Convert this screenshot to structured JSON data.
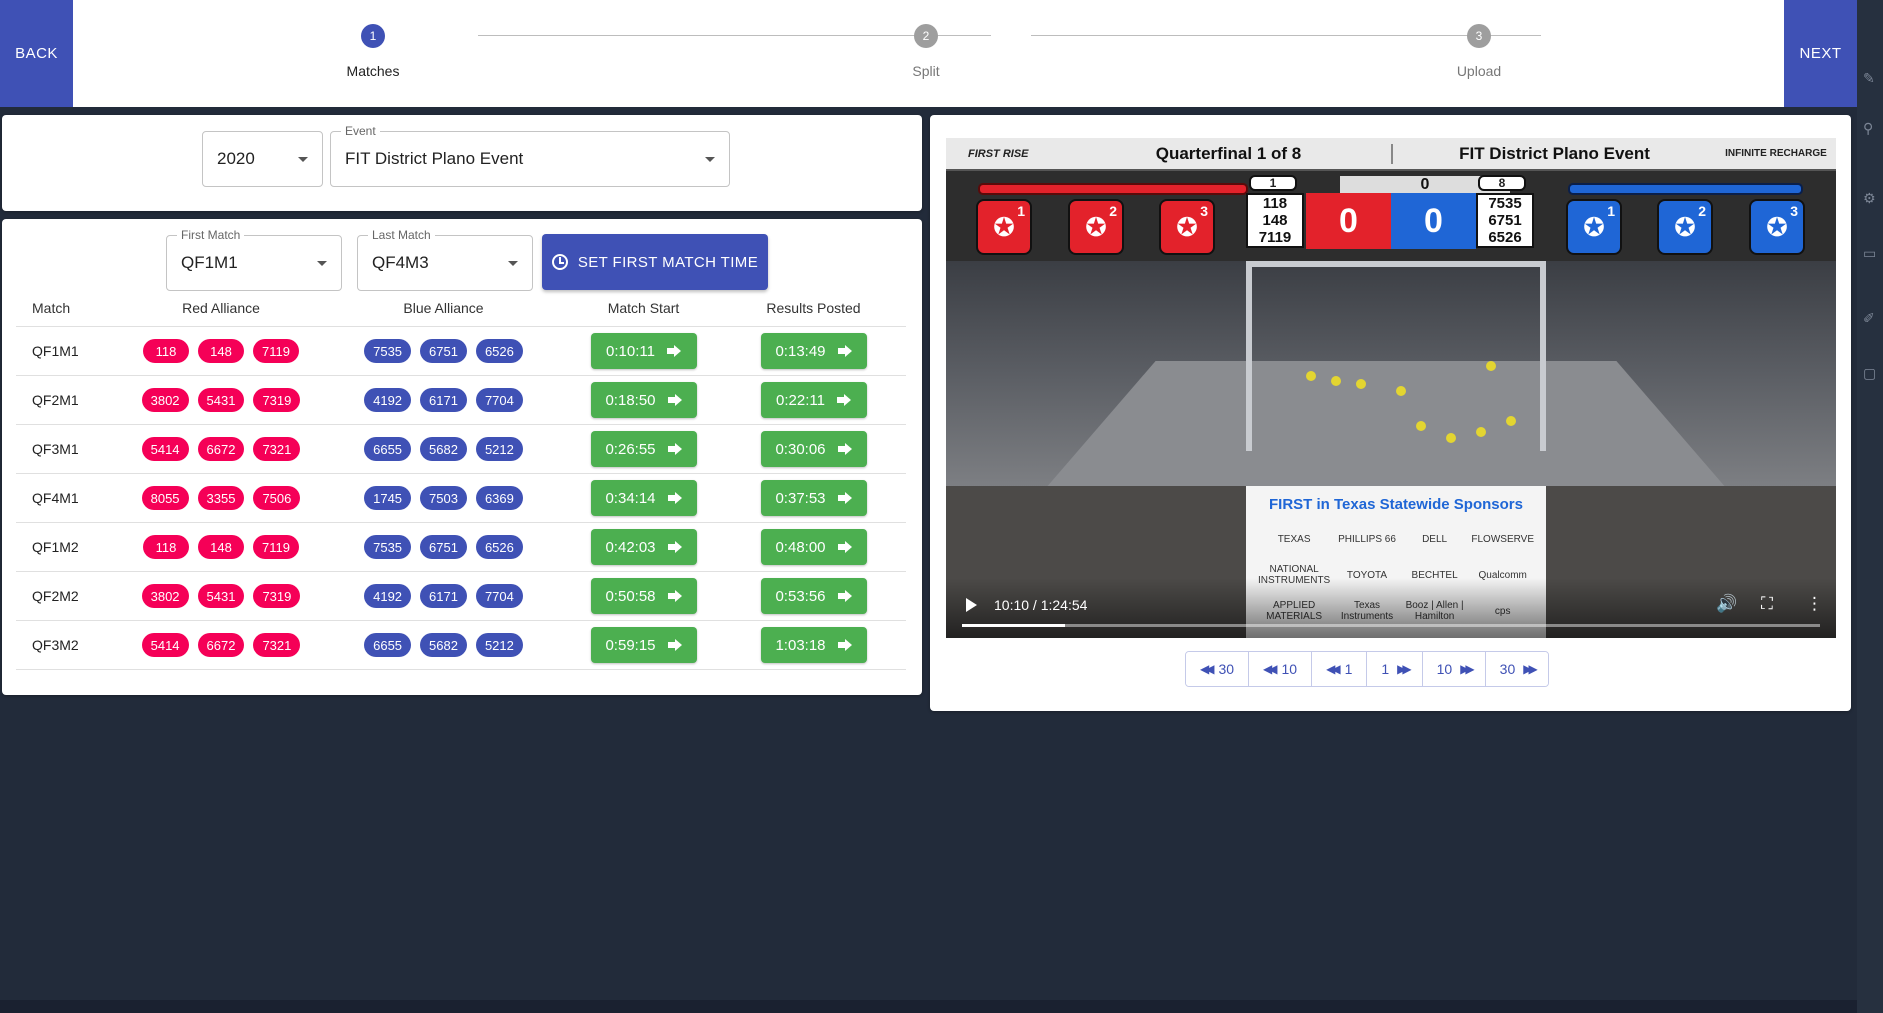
{
  "header": {
    "back_label": "BACK",
    "next_label": "NEXT",
    "steps": [
      {
        "number": "1",
        "label": "Matches",
        "active": true
      },
      {
        "number": "2",
        "label": "Split",
        "active": false
      },
      {
        "number": "3",
        "label": "Upload",
        "active": false
      }
    ]
  },
  "event_selector": {
    "year": "2020",
    "event_label": "Event",
    "event_value": "FIT District Plano Event"
  },
  "match_range": {
    "first_label": "First Match",
    "first_value": "QF1M1",
    "last_label": "Last Match",
    "last_value": "QF4M3",
    "set_time_label": "SET FIRST MATCH TIME"
  },
  "table": {
    "headers": [
      "Match",
      "Red Alliance",
      "Blue Alliance",
      "Match Start",
      "Results Posted"
    ],
    "rows": [
      {
        "match": "QF1M1",
        "red": [
          "118",
          "148",
          "7119"
        ],
        "blue": [
          "7535",
          "6751",
          "6526"
        ],
        "start": "0:10:11",
        "results": "0:13:49"
      },
      {
        "match": "QF2M1",
        "red": [
          "3802",
          "5431",
          "7319"
        ],
        "blue": [
          "4192",
          "6171",
          "7704"
        ],
        "start": "0:18:50",
        "results": "0:22:11"
      },
      {
        "match": "QF3M1",
        "red": [
          "5414",
          "6672",
          "7321"
        ],
        "blue": [
          "6655",
          "5682",
          "5212"
        ],
        "start": "0:26:55",
        "results": "0:30:06"
      },
      {
        "match": "QF4M1",
        "red": [
          "8055",
          "3355",
          "7506"
        ],
        "blue": [
          "1745",
          "7503",
          "6369"
        ],
        "start": "0:34:14",
        "results": "0:37:53"
      },
      {
        "match": "QF1M2",
        "red": [
          "118",
          "148",
          "7119"
        ],
        "blue": [
          "7535",
          "6751",
          "6526"
        ],
        "start": "0:42:03",
        "results": "0:48:00"
      },
      {
        "match": "QF2M2",
        "red": [
          "3802",
          "5431",
          "7319"
        ],
        "blue": [
          "4192",
          "6171",
          "7704"
        ],
        "start": "0:50:58",
        "results": "0:53:56"
      },
      {
        "match": "QF3M2",
        "red": [
          "5414",
          "6672",
          "7321"
        ],
        "blue": [
          "6655",
          "5682",
          "5212"
        ],
        "start": "0:59:15",
        "results": "1:03:18"
      }
    ]
  },
  "video": {
    "overlay_logo": "FIRST RISE",
    "overlay_match": "Quarterfinal 1 of 8",
    "overlay_event": "FIT District Plano Event",
    "overlay_game": "INFINITE RECHARGE",
    "red_rank": "1",
    "blue_rank": "8",
    "center_score": "0",
    "red_teams": [
      "118",
      "148",
      "7119"
    ],
    "blue_teams": [
      "7535",
      "6751",
      "6526"
    ],
    "red_score": "0",
    "blue_score": "0",
    "robot_numbers": [
      "1",
      "2",
      "3"
    ],
    "sponsors_title": "FIRST in Texas Statewide Sponsors",
    "sponsors": [
      "TEXAS",
      "PHILLIPS 66",
      "DELL",
      "FLOWSERVE",
      "NATIONAL INSTRUMENTS",
      "TOYOTA",
      "BECHTEL",
      "Qualcomm",
      "APPLIED MATERIALS",
      "Texas Instruments",
      "Booz | Allen | Hamilton",
      "cps"
    ],
    "time_display": "10:10 / 1:24:54",
    "progress": 0.12
  },
  "seek_buttons": [
    {
      "label": "30",
      "dir": "back"
    },
    {
      "label": "10",
      "dir": "back"
    },
    {
      "label": "1",
      "dir": "back"
    },
    {
      "label": "1",
      "dir": "forward"
    },
    {
      "label": "10",
      "dir": "forward"
    },
    {
      "label": "30",
      "dir": "forward"
    }
  ],
  "colors": {
    "primary": "#3f51b5",
    "red_chip": "#f50057",
    "green_button": "#4caf50",
    "background": "#222b3a"
  }
}
